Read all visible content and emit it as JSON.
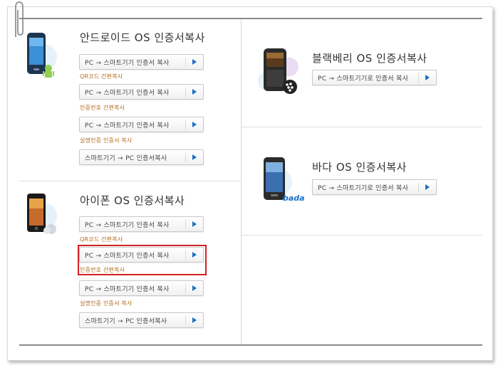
{
  "android": {
    "title": "안드로이드 OS 인증서복사",
    "items": [
      {
        "button": "PC → 스마트기기 인증서 복사",
        "caption": "QR코드 간편복사"
      },
      {
        "button": "PC → 스마트기기 인증서 복사",
        "caption": "인증번호 간편복사"
      },
      {
        "button": "PC → 스마트기기 인증서 복사",
        "caption": "실명인증 인증서 복사"
      },
      {
        "button": "스마트기기 → PC 인증서복사",
        "caption": ""
      }
    ]
  },
  "iphone": {
    "title": "아이폰 OS 인증서복사",
    "items": [
      {
        "button": "PC → 스마트기기 인증서 복사",
        "caption": "QR코드 간편복사"
      },
      {
        "button": "PC → 스마트기기 인증서 복사",
        "caption": "인증번호 간편복사"
      },
      {
        "button": "PC → 스마트기기 인증서 복사",
        "caption": "실명인증 인증서 복사"
      },
      {
        "button": "스마트기기 → PC 인증서복사",
        "caption": ""
      }
    ]
  },
  "blackberry": {
    "title": "블랙베리 OS 인증서복사",
    "button": "PC → 스마트기기로 인증서 복사"
  },
  "bada": {
    "title": "바다 OS 인증서복사",
    "button": "PC → 스마트기기로 인증서 복사",
    "logo_text": "bada"
  },
  "colors": {
    "accent_arrow": "#1a6fc7",
    "caption": "#b06b1c",
    "highlight": "#d42020"
  }
}
